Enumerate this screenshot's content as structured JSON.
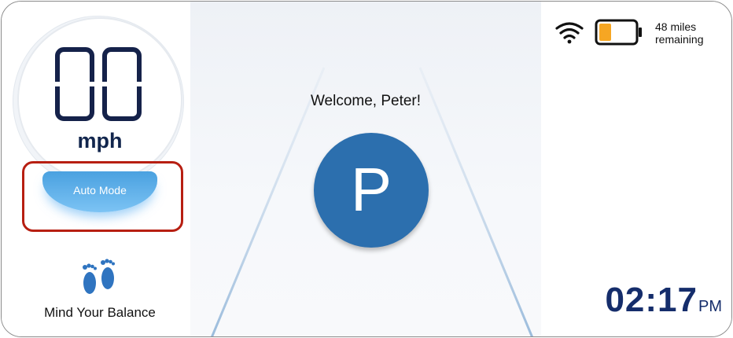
{
  "speedometer": {
    "speed_value": "00",
    "speed_unit": "mph"
  },
  "mode": {
    "label": "Auto Mode"
  },
  "balance": {
    "icon": "footprints-icon",
    "label": "Mind Your Balance"
  },
  "center": {
    "welcome": "Welcome, Peter!",
    "gear": "P"
  },
  "status": {
    "wifi_icon": "wifi-icon",
    "battery_icon": "battery-icon",
    "battery_level": 0.33,
    "battery_color": "#f6a623",
    "range_line1": "48 miles",
    "range_line2": "remaining"
  },
  "clock": {
    "time": "02:17",
    "ampm": "PM"
  },
  "colors": {
    "accent": "#2c6fae",
    "mode_blue": "#4aa1e0",
    "highlight": "#b71f12",
    "text_dark": "#12264d"
  }
}
